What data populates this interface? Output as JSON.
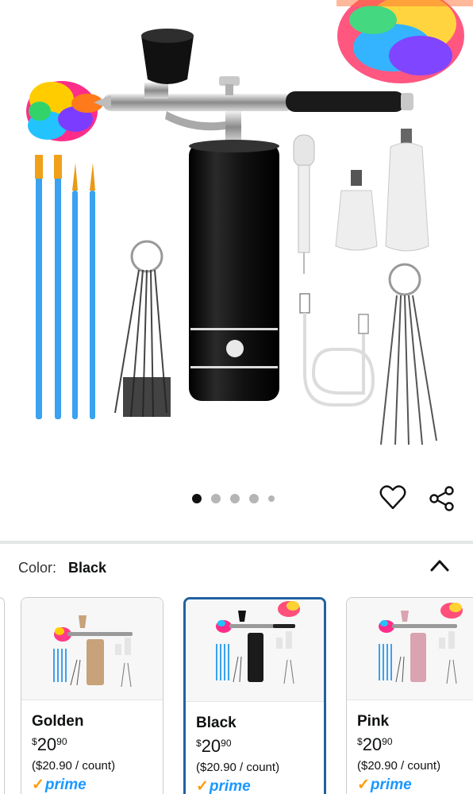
{
  "gallery": {
    "dots": [
      {
        "active": true
      },
      {
        "active": false
      },
      {
        "active": false
      },
      {
        "active": false
      },
      {
        "active": false
      }
    ],
    "favorite_icon": "heart-outline-icon",
    "share_icon": "share-icon"
  },
  "variation": {
    "label": "Color:",
    "selected": "Black",
    "toggle_icon": "chevron-up-icon"
  },
  "options": [
    {
      "name": "Golden",
      "currency": "$",
      "whole": "20",
      "cents": "90",
      "unit_price": "($20.90 / count)",
      "badge": "prime",
      "body_color": "#c8a27a"
    },
    {
      "name": "Black",
      "currency": "$",
      "whole": "20",
      "cents": "90",
      "unit_price": "($20.90 / count)",
      "badge": "prime",
      "body_color": "#1b1b1b"
    },
    {
      "name": "Pink",
      "currency": "$",
      "whole": "20",
      "cents": "90",
      "unit_price": "($20.90 / count)",
      "badge": "prime",
      "body_color": "#d9a3b0"
    }
  ],
  "colors": {
    "accent_selected": "#2162a1",
    "prime_blue": "#1a98ff",
    "prime_check": "#ff9900"
  }
}
